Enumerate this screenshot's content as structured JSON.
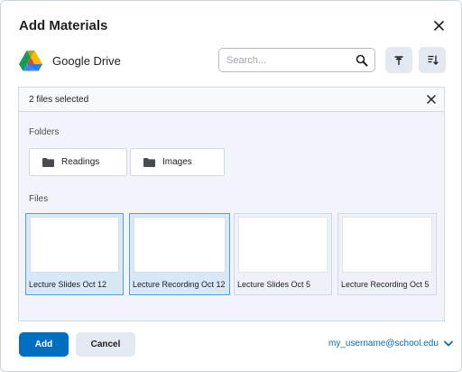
{
  "dialog": {
    "title": "Add Materials",
    "close_icon": "close-icon"
  },
  "provider": {
    "name": "Google Drive",
    "logo_icon": "google-drive-logo"
  },
  "search": {
    "placeholder": "Search...",
    "icon": "search-icon"
  },
  "toolbar": {
    "filter_icon": "filter-icon",
    "sort_icon": "sort-icon"
  },
  "selection": {
    "text": "2 files selected",
    "clear_icon": "close-icon"
  },
  "folders": {
    "label": "Folders",
    "items": [
      {
        "label": "Readings",
        "icon": "folder-icon"
      },
      {
        "label": "Images",
        "icon": "folder-icon"
      }
    ]
  },
  "files": {
    "label": "Files",
    "items": [
      {
        "label": "Lecture Slides Oct 12",
        "selected": true
      },
      {
        "label": "Lecture Recording Oct 12",
        "selected": true
      },
      {
        "label": "Lecture Slides Oct 5",
        "selected": false
      },
      {
        "label": "Lecture Recording Oct 5",
        "selected": false
      }
    ]
  },
  "footer": {
    "add_label": "Add",
    "cancel_label": "Cancel",
    "account": "my_username@school.edu",
    "account_icon": "chevron-down-icon"
  },
  "colors": {
    "primary": "#006fbf",
    "selected_border": "#5b9ad3",
    "selected_fill": "#d8e8f7",
    "panel_bg": "#f1f5fb"
  }
}
